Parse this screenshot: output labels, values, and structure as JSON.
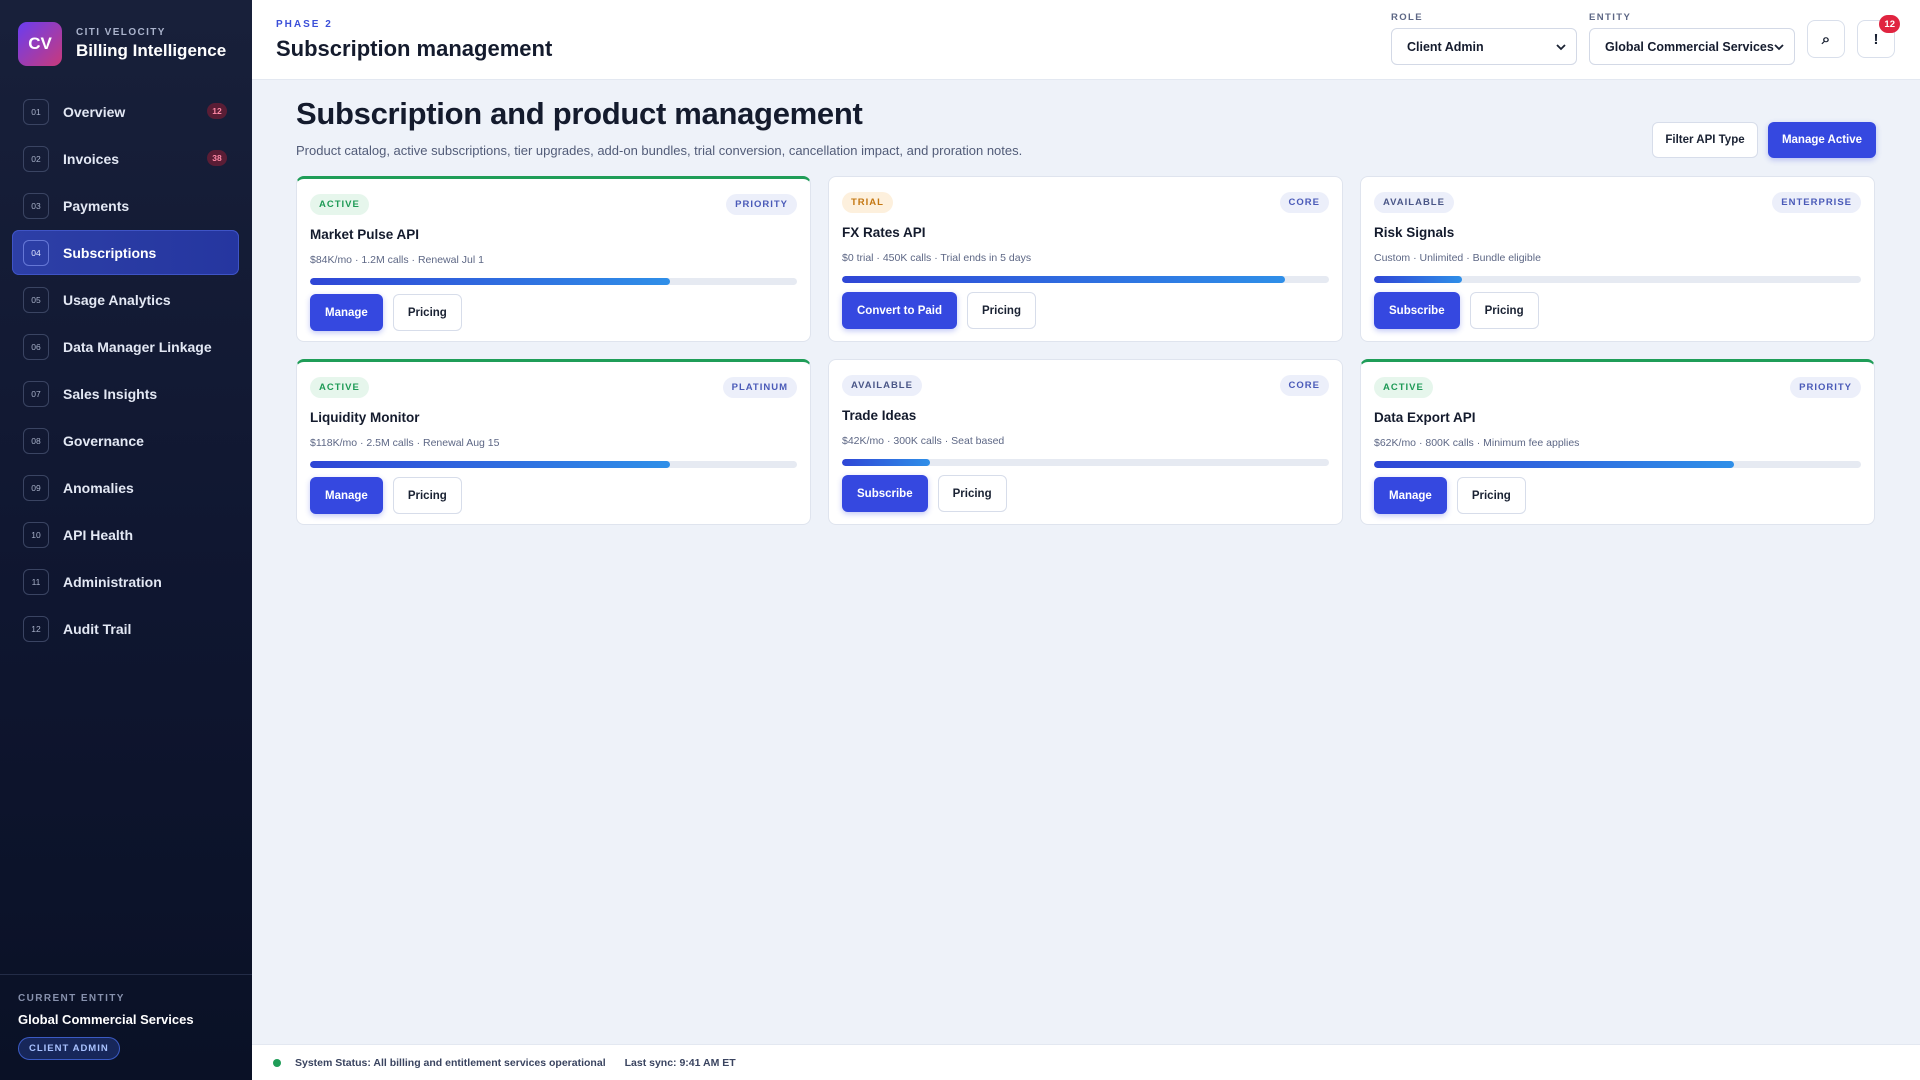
{
  "brand": {
    "logo": "CV",
    "subtitle": "CITI VELOCITY",
    "title": "Billing Intelligence"
  },
  "nav": [
    {
      "num": "01",
      "label": "Overview",
      "badge": "12"
    },
    {
      "num": "02",
      "label": "Invoices",
      "badge": "38"
    },
    {
      "num": "03",
      "label": "Payments",
      "badge": ""
    },
    {
      "num": "04",
      "label": "Subscriptions",
      "badge": "",
      "active": true
    },
    {
      "num": "05",
      "label": "Usage Analytics",
      "badge": ""
    },
    {
      "num": "06",
      "label": "Data Manager Linkage",
      "badge": ""
    },
    {
      "num": "07",
      "label": "Sales Insights",
      "badge": ""
    },
    {
      "num": "08",
      "label": "Governance",
      "badge": ""
    },
    {
      "num": "09",
      "label": "Anomalies",
      "badge": ""
    },
    {
      "num": "10",
      "label": "API Health",
      "badge": ""
    },
    {
      "num": "11",
      "label": "Administration",
      "badge": ""
    },
    {
      "num": "12",
      "label": "Audit Trail",
      "badge": ""
    }
  ],
  "sidebar_footer": {
    "label": "CURRENT ENTITY",
    "entity": "Global Commercial Services",
    "role": "CLIENT ADMIN"
  },
  "header": {
    "phase": "PHASE 2",
    "title": "Subscription management",
    "role_label": "ROLE",
    "role_value": "Client Admin",
    "entity_label": "ENTITY",
    "entity_value": "Global Commercial Services",
    "search_icon": "search-icon",
    "alert_icon": "alert-icon",
    "alert_glyph": "!",
    "search_glyph": "⌕",
    "notif_count": "12"
  },
  "main": {
    "title": "Subscription and product management",
    "description": "Product catalog, active subscriptions, tier upgrades, add-on bundles, trial conversion, cancellation impact, and proration notes.",
    "filter_button": "Filter API Type",
    "manage_button": "Manage Active"
  },
  "cards": [
    {
      "status": "ACTIVE",
      "status_kind": "active",
      "tier": "PRIORITY",
      "name": "Market Pulse API",
      "meta": "$84K/mo · 1.2M calls · Renewal Jul 1",
      "progress": 0.74,
      "primary": "Manage",
      "secondary": "Pricing"
    },
    {
      "status": "TRIAL",
      "status_kind": "trial",
      "tier": "CORE",
      "name": "FX Rates API",
      "meta": "$0 trial · 450K calls · Trial ends in 5 days",
      "progress": 0.91,
      "primary": "Convert to Paid",
      "secondary": "Pricing"
    },
    {
      "status": "AVAILABLE",
      "status_kind": "available",
      "tier": "ENTERPRISE",
      "name": "Risk Signals",
      "meta": "Custom · Unlimited · Bundle eligible",
      "progress": 0.18,
      "primary": "Subscribe",
      "secondary": "Pricing"
    },
    {
      "status": "ACTIVE",
      "status_kind": "active",
      "tier": "PLATINUM",
      "name": "Liquidity Monitor",
      "meta": "$118K/mo · 2.5M calls · Renewal Aug 15",
      "progress": 0.74,
      "primary": "Manage",
      "secondary": "Pricing"
    },
    {
      "status": "AVAILABLE",
      "status_kind": "available",
      "tier": "CORE",
      "name": "Trade Ideas",
      "meta": "$42K/mo · 300K calls · Seat based",
      "progress": 0.18,
      "primary": "Subscribe",
      "secondary": "Pricing"
    },
    {
      "status": "ACTIVE",
      "status_kind": "active",
      "tier": "PRIORITY",
      "name": "Data Export API",
      "meta": "$62K/mo · 800K calls · Minimum fee applies",
      "progress": 0.74,
      "primary": "Manage",
      "secondary": "Pricing"
    }
  ],
  "statusbar": {
    "status": "System Status: All billing and entitlement services operational",
    "sync": "Last sync: 9:41 AM ET"
  },
  "colors": {
    "accent": "#3548e0",
    "active_green": "#1f9d58",
    "alert_red": "#e02440"
  }
}
